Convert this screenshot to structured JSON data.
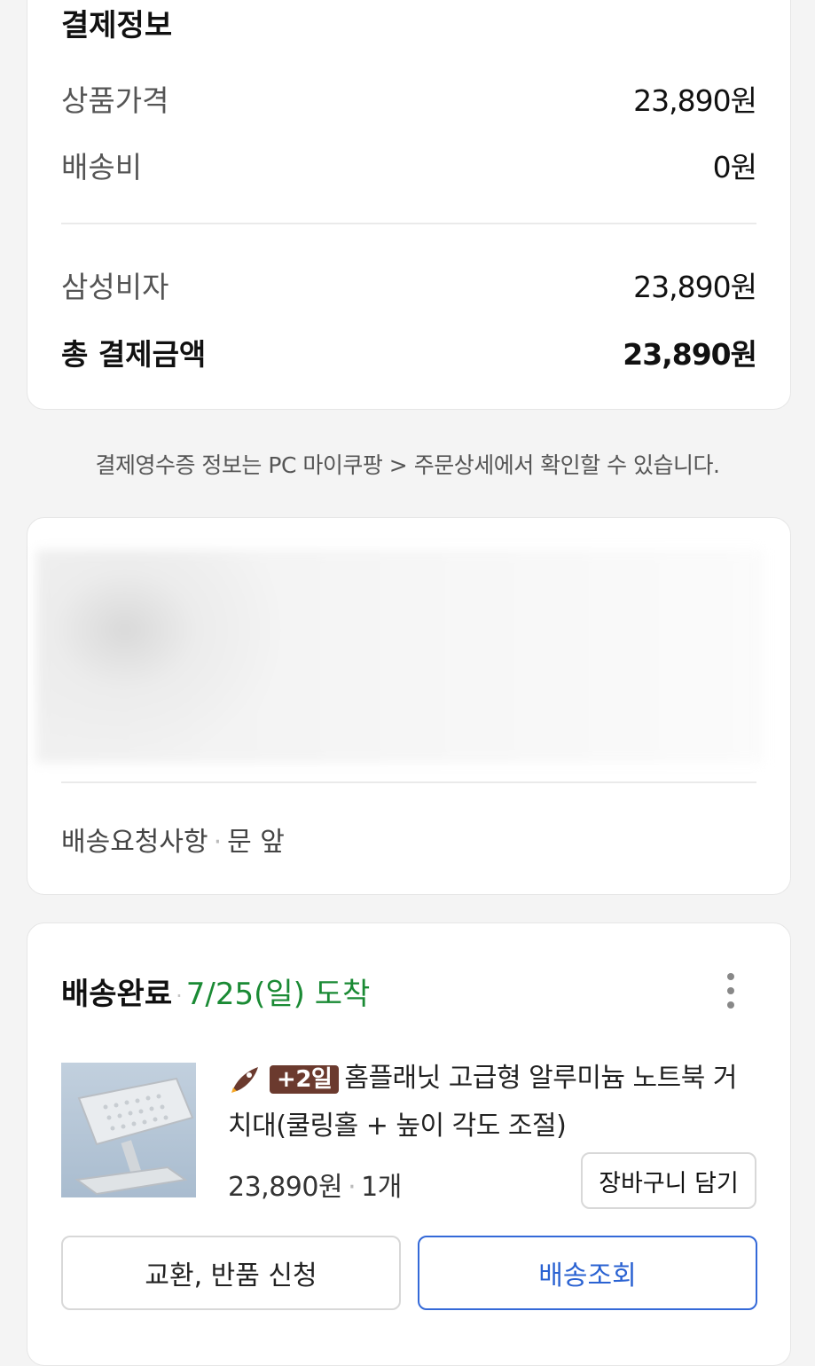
{
  "payment": {
    "title": "결제정보",
    "product_price_label": "상품가격",
    "product_price_value": "23,890원",
    "shipping_label": "배송비",
    "shipping_value": "0원",
    "method_label": "삼성비자",
    "method_value": "23,890원",
    "total_label": "총 결제금액",
    "total_value": "23,890원"
  },
  "receipt_note": "결제영수증 정보는 PC 마이쿠팡 > 주문상세에서 확인할 수 있습니다.",
  "delivery_address": {
    "request_label": "배송요청사항",
    "separator": "·",
    "request_value": "문 앞"
  },
  "order": {
    "status": "배송완료",
    "separator": "·",
    "arrival": "7/25(일) 도착",
    "badge_text": "+2일",
    "product_name": "홈플래닛 고급형 알루미늄 노트북 거치대(쿨링홀 + 높이 각도 조절)",
    "price": "23,890원",
    "quantity": "1개",
    "add_to_cart": "장바구니 담기",
    "exchange_return": "교환, 반품 신청",
    "track_delivery": "배송조회",
    "icons": {
      "menu": "more-vertical-icon",
      "rocket": "rocket-delivery-icon"
    },
    "colors": {
      "arrival": "#1a8a34",
      "badge_bg": "#6b3a2e",
      "primary": "#2a62d2"
    }
  }
}
